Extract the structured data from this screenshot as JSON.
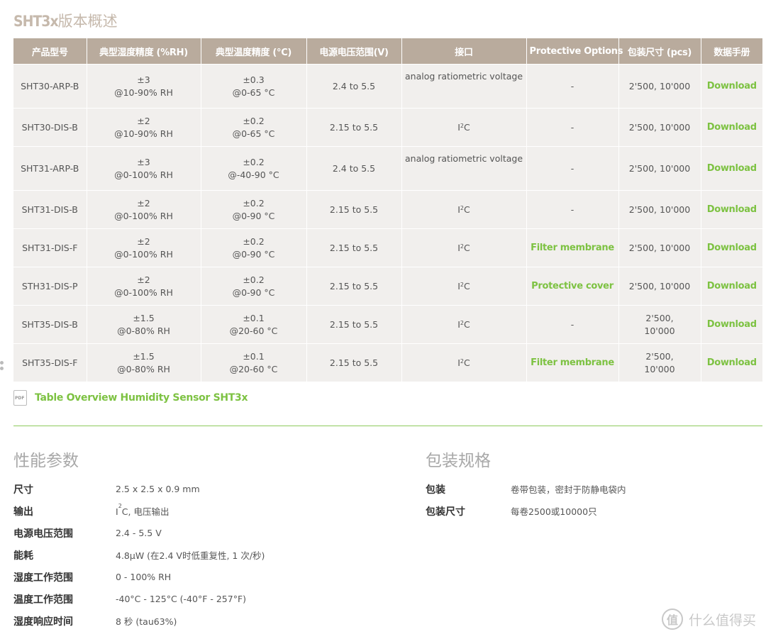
{
  "section_title": {
    "prefix": "SHT3x",
    "suffix": "版本概述"
  },
  "table": {
    "headers": [
      "产品型号",
      "典型湿度精度 (%RH)",
      "典型温度精度 (°C)",
      "电源电压范围(V)",
      "接口",
      "Protective Options",
      "包装尺寸 (pcs)",
      "数据手册"
    ],
    "rows": [
      {
        "model": "SHT30-ARP-B",
        "rh_1": "±3",
        "rh_2": "@10-90% RH",
        "t_1": "±0.3",
        "t_2": "@0-65 °C",
        "voltage": "2.4 to 5.5",
        "iface": "analog ratiometric voltage",
        "iface_sup": "",
        "iface_tail": "",
        "protect": "-",
        "pack_1": "2'500, 10'000",
        "pack_2": "",
        "datasheet": "Download"
      },
      {
        "model": "SHT30-DIS-B",
        "rh_1": "±2",
        "rh_2": "@10-90% RH",
        "t_1": "±0.2",
        "t_2": "@0-65 °C",
        "voltage": "2.15 to 5.5",
        "iface": "I",
        "iface_sup": "2",
        "iface_tail": "C",
        "protect": "-",
        "pack_1": "2'500, 10'000",
        "pack_2": "",
        "datasheet": "Download"
      },
      {
        "model": "SHT31-ARP-B",
        "rh_1": "±3",
        "rh_2": "@0-100% RH",
        "t_1": "±0.2",
        "t_2": "@-40-90 °C",
        "voltage": "2.4 to 5.5",
        "iface": "analog ratiometric voltage",
        "iface_sup": "",
        "iface_tail": "",
        "protect": "-",
        "pack_1": "2'500, 10'000",
        "pack_2": "",
        "datasheet": "Download"
      },
      {
        "model": "SHT31-DIS-B",
        "rh_1": "±2",
        "rh_2": "@0-100% RH",
        "t_1": "±0.2",
        "t_2": "@0-90 °C",
        "voltage": "2.15 to 5.5",
        "iface": "I",
        "iface_sup": "2",
        "iface_tail": "C",
        "protect": "-",
        "pack_1": "2'500, 10'000",
        "pack_2": "",
        "datasheet": "Download"
      },
      {
        "model": "SHT31-DIS-F",
        "rh_1": "±2",
        "rh_2": "@0-100% RH",
        "t_1": "±0.2",
        "t_2": "@0-90 °C",
        "voltage": "2.15 to 5.5",
        "iface": "I",
        "iface_sup": "2",
        "iface_tail": "C",
        "protect": "Filter membrane",
        "pack_1": "2'500, 10'000",
        "pack_2": "",
        "datasheet": "Download"
      },
      {
        "model": "STH31-DIS-P",
        "rh_1": "±2",
        "rh_2": "@0-100% RH",
        "t_1": "±0.2",
        "t_2": "@0-90 °C",
        "voltage": "2.15 to 5.5",
        "iface": "I",
        "iface_sup": "2",
        "iface_tail": "C",
        "protect": "Protective cover",
        "pack_1": "2'500, 10'000",
        "pack_2": "",
        "datasheet": "Download"
      },
      {
        "model": "SHT35-DIS-B",
        "rh_1": "±1.5",
        "rh_2": "@0-80% RH",
        "t_1": "±0.1",
        "t_2": "@20-60 °C",
        "voltage": "2.15 to 5.5",
        "iface": "I",
        "iface_sup": "2",
        "iface_tail": "C",
        "protect": "-",
        "pack_1": "2'500,",
        "pack_2": "10'000",
        "datasheet": "Download"
      },
      {
        "model": "SHT35-DIS-F",
        "rh_1": "±1.5",
        "rh_2": "@0-80% RH",
        "t_1": "±0.1",
        "t_2": "@20-60 °C",
        "voltage": "2.15 to 5.5",
        "iface": "I",
        "iface_sup": "2",
        "iface_tail": "C",
        "protect": "Filter membrane",
        "pack_1": "2'500,",
        "pack_2": "10'000",
        "datasheet": "Download"
      }
    ]
  },
  "pdf_link": {
    "icon_text": "PDF",
    "label": "Table Overview Humidity Sensor SHT3x"
  },
  "performance": {
    "title": "性能参数",
    "rows": [
      {
        "key": "尺寸",
        "value": "2.5 x 2.5 x 0.9 mm"
      },
      {
        "key": "输出",
        "value_pre": "I",
        "value_sup": "2",
        "value": "C, 电压输出"
      },
      {
        "key": "电源电压范围",
        "value": "2.4 - 5.5 V"
      },
      {
        "key": "能耗",
        "value": "4.8µW (在2.4 V时低重复性, 1 次/秒)"
      },
      {
        "key": "湿度工作范围",
        "value": "0 - 100% RH"
      },
      {
        "key": "温度工作范围",
        "value": "-40°C - 125°C (-40°F - 257°F)"
      },
      {
        "key": "湿度响应时间",
        "value": "8 秒 (tau63%)"
      }
    ]
  },
  "packaging": {
    "title": "包装规格",
    "rows": [
      {
        "key": "包装",
        "value": "卷带包装，密封于防静电袋内"
      },
      {
        "key": "包装尺寸",
        "value": "每卷2500或10000只"
      }
    ]
  },
  "watermark": {
    "icon": "值",
    "text": "什么值得买"
  },
  "colors": {
    "header_bg": "#b9ab9d",
    "cell_bg": "#f1efed",
    "accent_green": "#7dc242",
    "title_gray": "#c6b9ac"
  }
}
